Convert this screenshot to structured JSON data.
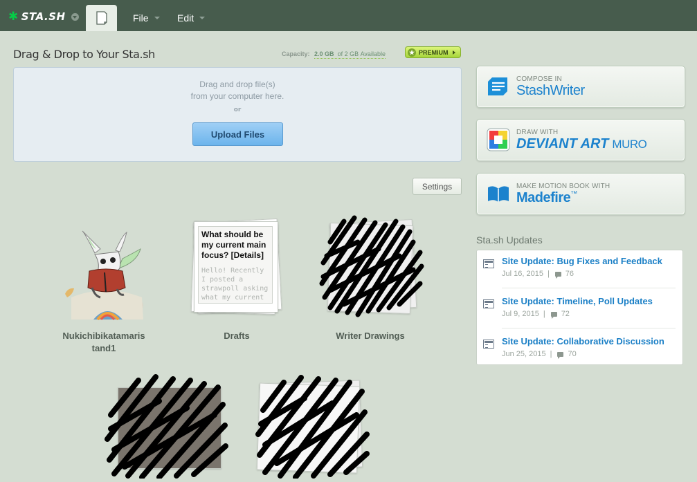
{
  "topbar": {
    "logo_text": "STA.SH",
    "menu": {
      "file": "File",
      "edit": "Edit"
    }
  },
  "header": {
    "title": "Drag & Drop to Your Sta.sh",
    "capacity_label": "Capacity:",
    "capacity_used": "2.0 GB",
    "capacity_total": "of 2 GB",
    "capacity_suffix": "Available",
    "premium": "PREMIUM"
  },
  "dropzone": {
    "line1": "Drag and drop file(s)",
    "line2": "from your computer here.",
    "or": "or",
    "upload": "Upload Files"
  },
  "settings": "Settings",
  "gallery": [
    {
      "label": "Nukichibikatamaris tand1"
    },
    {
      "label": "Drafts",
      "draft_title": "What should be my current main focus? [Details]",
      "draft_body": "Hello! Recently I posted a strawpoll asking what my current"
    },
    {
      "label": "Writer Drawings"
    }
  ],
  "promos": [
    {
      "small": "COMPOSE IN",
      "big_a": "Stash",
      "big_b": "Writer",
      "icon": "stashwriter-icon"
    },
    {
      "small": "DRAW WITH",
      "big_a": "DEVIANT ART",
      "big_b": "MURO",
      "icon": "muro-icon"
    },
    {
      "small": "MAKE MOTION BOOK WITH",
      "big_a": "Madefire",
      "big_b": "™",
      "icon": "madefire-icon"
    }
  ],
  "updates": {
    "title": "Sta.sh Updates",
    "items": [
      {
        "title": "Site Update: Bug Fixes and Feedback",
        "date": "Jul 16, 2015",
        "sep": "|",
        "comments": "76"
      },
      {
        "title": "Site Update: Timeline, Poll Updates",
        "date": "Jul 9, 2015",
        "sep": "|",
        "comments": "72"
      },
      {
        "title": "Site Update: Collaborative Discussion",
        "date": "Jun 25, 2015",
        "sep": "|",
        "comments": "70"
      }
    ]
  },
  "colors": {
    "topbar": "#475c4d",
    "background": "#d4ddd2",
    "link": "#1a7fc6",
    "accent_green": "#05cc47"
  }
}
